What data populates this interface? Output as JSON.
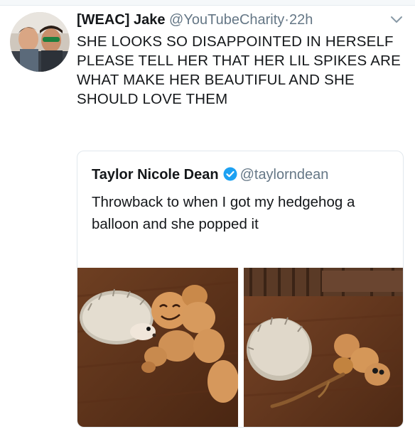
{
  "tweet": {
    "author_name": "[WEAC] Jake",
    "author_handle": "@YouTubeCharity",
    "separator": "·",
    "time": "22h",
    "text": "SHE LOOKS SO DISAPPOINTED IN HERSELF PLEASE TELL HER THAT HER LIL SPIKES ARE WHAT MAKE HER BEAUTIFUL AND SHE SHOULD LOVE THEM",
    "avatar_icon": "avatar-photo",
    "menu_icon": "chevron-down-icon"
  },
  "quoted": {
    "author_name": "Taylor Nicole Dean",
    "verified_icon": "verified-badge-icon",
    "author_handle": "@taylorndean",
    "text": "Throwback to when I got my hedgehog a balloon and she popped it",
    "media": [
      {
        "name": "hedgehog-with-balloon-photo"
      },
      {
        "name": "hedgehog-with-popped-balloon-photo"
      }
    ]
  },
  "colors": {
    "text": "#14171a",
    "secondary": "#657786",
    "verified": "#1da1f2",
    "border": "#e1e8ed"
  }
}
